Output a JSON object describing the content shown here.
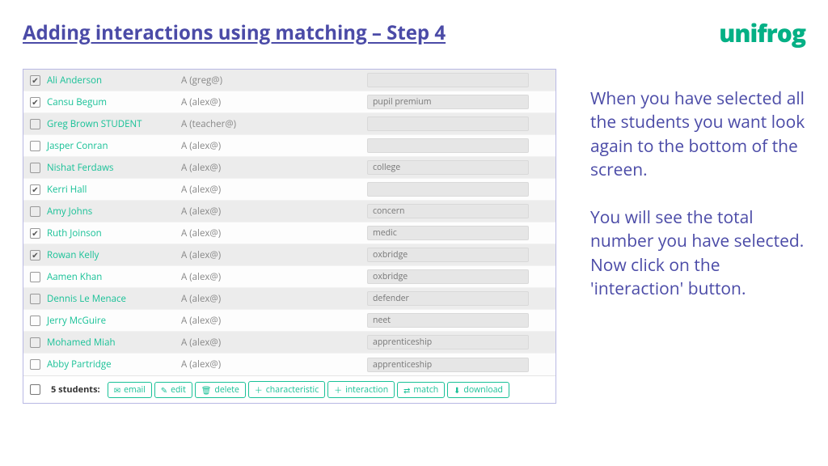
{
  "title": "Adding interactions using matching – Step 4",
  "logo": "unifrog",
  "students": [
    {
      "name": "Ali Anderson",
      "group": "A (greg@)",
      "tag": "",
      "checked": true
    },
    {
      "name": "Cansu Begum",
      "group": "A (alex@)",
      "tag": "pupil premium",
      "checked": true
    },
    {
      "name": "Greg Brown STUDENT",
      "group": "A (teacher@)",
      "tag": "",
      "checked": false
    },
    {
      "name": "Jasper Conran",
      "group": "A (alex@)",
      "tag": "",
      "checked": false
    },
    {
      "name": "Nishat Ferdaws",
      "group": "A (alex@)",
      "tag": "college",
      "checked": false
    },
    {
      "name": "Kerri Hall",
      "group": "A (alex@)",
      "tag": "",
      "checked": true
    },
    {
      "name": "Amy Johns",
      "group": "A (alex@)",
      "tag": "concern",
      "checked": false
    },
    {
      "name": "Ruth Joinson",
      "group": "A (alex@)",
      "tag": "medic",
      "checked": true
    },
    {
      "name": "Rowan Kelly",
      "group": "A (alex@)",
      "tag": "oxbridge",
      "checked": true
    },
    {
      "name": "Aamen Khan",
      "group": "A (alex@)",
      "tag": "oxbridge",
      "checked": false
    },
    {
      "name": "Dennis Le Menace",
      "group": "A (alex@)",
      "tag": "defender",
      "checked": false
    },
    {
      "name": "Jerry McGuire",
      "group": "A (alex@)",
      "tag": "neet",
      "checked": false
    },
    {
      "name": "Mohamed Miah",
      "group": "A (alex@)",
      "tag": "apprenticeship",
      "checked": false
    },
    {
      "name": "Abby Partridge",
      "group": "A (alex@)",
      "tag": "apprenticeship",
      "checked": false
    }
  ],
  "footer": {
    "count_label": "5 students:",
    "buttons": [
      {
        "icon": "✉",
        "label": "email"
      },
      {
        "icon": "✎",
        "label": "edit"
      },
      {
        "icon": "🗑",
        "label": "delete"
      },
      {
        "icon": "＋",
        "label": "characteristic"
      },
      {
        "icon": "＋",
        "label": "interaction"
      },
      {
        "icon": "⇄",
        "label": "match"
      },
      {
        "icon": "⬇",
        "label": "download"
      }
    ]
  },
  "sidetext": "When you have selected all the students you want look again to the bottom of the screen.\n\nYou will see the total number you have selected.\nNow click on the 'interaction' button."
}
